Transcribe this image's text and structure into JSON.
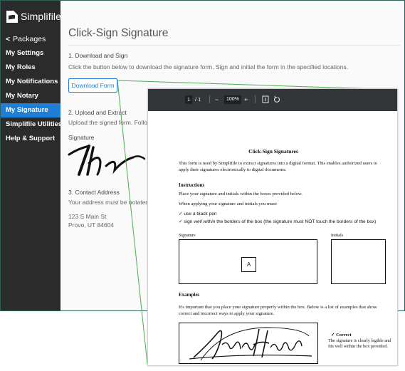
{
  "brand": {
    "name": "Simplifile"
  },
  "sidebar": {
    "back_label": "Packages",
    "items": [
      {
        "label": "My Settings"
      },
      {
        "label": "My Roles"
      },
      {
        "label": "My Notifications"
      },
      {
        "label": "My Notary"
      },
      {
        "label": "My Signature",
        "active": true
      },
      {
        "label": "Simplifile Utilities"
      },
      {
        "label": "Help & Support"
      }
    ]
  },
  "main": {
    "title": "Click-Sign Signature",
    "step1": {
      "title": "1. Download and Sign",
      "text": "Click the button below to download the signature form. Sign and initial the form in the specified locations.",
      "button_label": "Download Form"
    },
    "step2": {
      "title": "2. Upload and Extract",
      "text": "Upload the signed form. Follow the",
      "signature_label": "Signature"
    },
    "step3": {
      "title": "3. Contact Address",
      "text": "Your address must be notated in y",
      "address_line1": "123 S Main St",
      "address_line2": "Provo, UT 84604"
    }
  },
  "pdf_viewer": {
    "toolbar": {
      "page_current": "1",
      "page_total": "/ 1",
      "zoom_out": "−",
      "zoom": "100%",
      "zoom_in": "+"
    },
    "document": {
      "title": "Click-Sign Signatures",
      "intro": "This form is used by Simplifile to extract signatures into a digital format. This enables authorized users to apply their signatures electronically to digital documents.",
      "instructions_heading": "Instructions",
      "instructions_text": "Place your signature and initials within the boxes provided below.",
      "when_applying": "When applying your signature and initials you must:",
      "rule1": "✓ use a black pen",
      "rule2_prefix": "✓ sign ",
      "rule2_emphasis": "well within",
      "rule2_suffix": " the borders of the box (the signature must NOT touch the borders of the box)",
      "signature_label": "Signature",
      "initials_label": "Initials",
      "marker": "A",
      "examples_heading": "Examples",
      "examples_text": "It's important that you place your signature properly within the box. Below is a list of examples that show correct and incorrect ways to apply your signature.",
      "correct_title": "✓ Correct",
      "correct_text": "The signature is clearly legible and fits well within the box provided."
    }
  },
  "colors": {
    "sidebar_bg": "#2b2b2b",
    "active_blue": "#1f7fd6",
    "connector_green": "#4caf50",
    "toolbar_bg": "#323639"
  }
}
